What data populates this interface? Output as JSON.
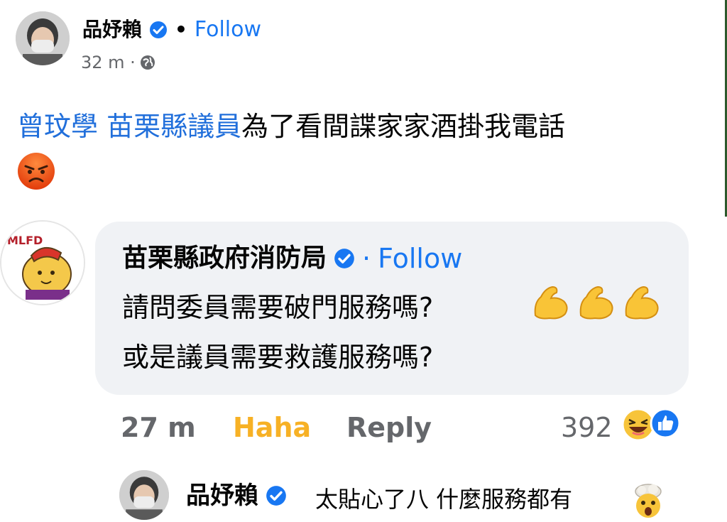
{
  "post": {
    "author": "品妤賴",
    "follow": "Follow",
    "separator": "•",
    "time": "32 m ·",
    "tag1": "曾玟學",
    "tag2": "苗栗縣議員",
    "text": "為了看間諜家家酒掛我電話",
    "emoji": "angry-face-icon"
  },
  "comment": {
    "author": "苗栗縣政府消防局",
    "avatar_text": "MLFD",
    "follow_sep": "·",
    "follow": "Follow",
    "line1": "請問委員需要破門服務嗎?",
    "line2": "或是議員需要救護服務嗎?",
    "emoji": "flexed-biceps-icon",
    "time": "27 m",
    "reaction": "Haha",
    "reply": "Reply",
    "count": "392",
    "reaction_icons": [
      "laughing-face-icon",
      "like-icon"
    ]
  },
  "reply": {
    "author": "品妤賴",
    "text": "太貼心了八 什麼服務都有",
    "emoji": "exploding-head-icon"
  },
  "colors": {
    "link": "#216fdb",
    "follow": "#1877f2",
    "haha": "#f7b125",
    "muted": "#65676b",
    "bubble": "#f0f2f5"
  }
}
